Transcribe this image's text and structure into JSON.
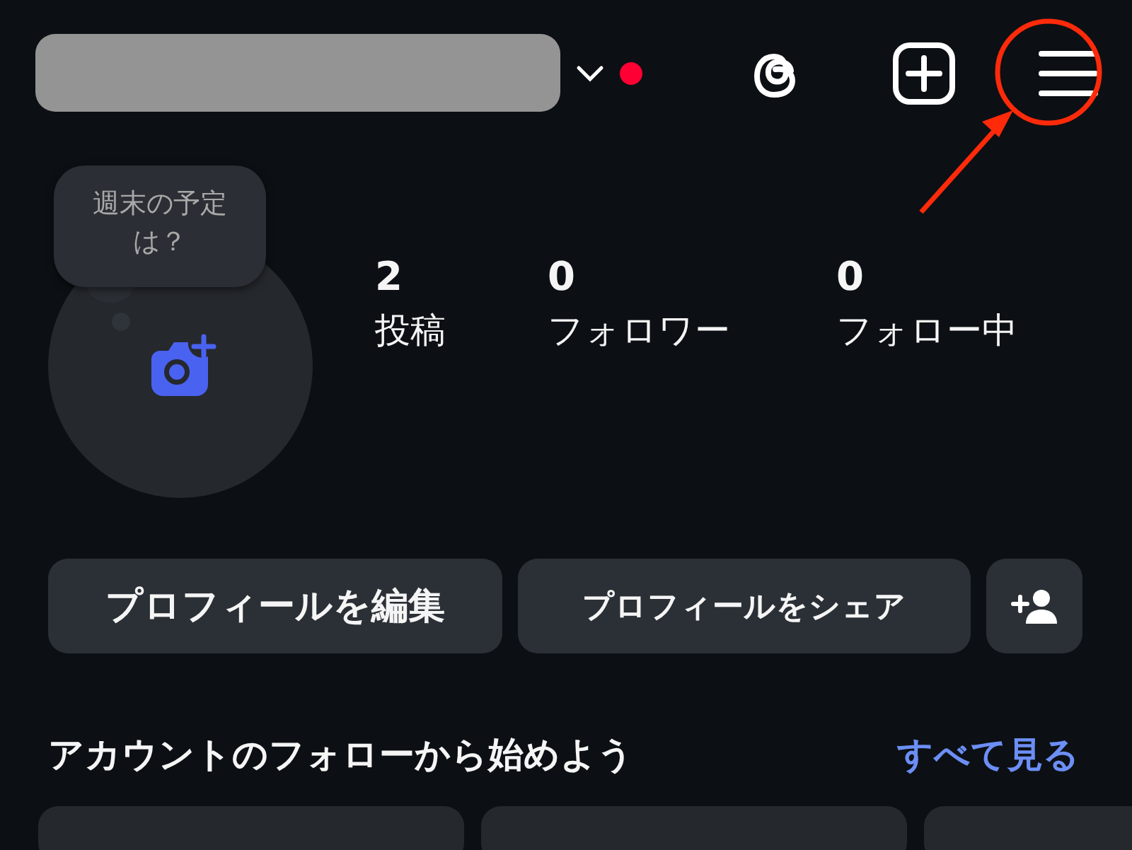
{
  "header": {
    "has_notification": true
  },
  "avatar": {
    "note": "週末の予定は？"
  },
  "stats": [
    {
      "value": "2",
      "label": "投稿"
    },
    {
      "value": "0",
      "label": "フォロワー"
    },
    {
      "value": "0",
      "label": "フォロー中"
    }
  ],
  "buttons": [
    "プロフィールを編集",
    "プロフィールをシェア"
  ],
  "suggestions": {
    "title": "アカウントのフォローから始めよう",
    "link": "すべて見る"
  }
}
